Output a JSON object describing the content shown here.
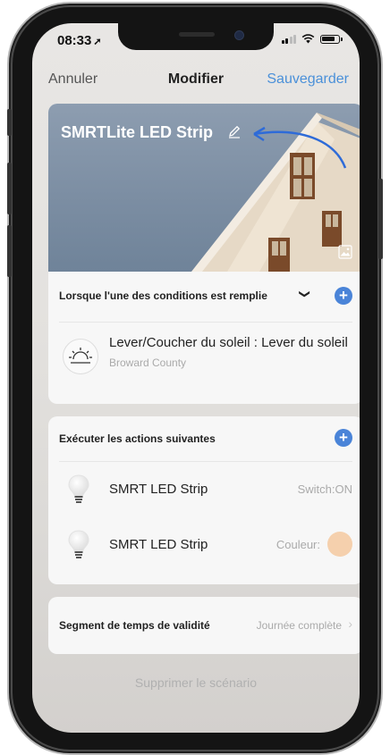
{
  "status": {
    "time": "08:33",
    "location_arrow": "➚"
  },
  "nav": {
    "cancel": "Annuler",
    "title": "Modifier",
    "save": "Sauvegarder"
  },
  "scene": {
    "name": "SMRTLite LED Strip",
    "edit_icon": "pencil-icon",
    "photo_icon": "image-icon"
  },
  "conditions": {
    "header": "Lorsque l'une des conditions est remplie",
    "chevron": "❯",
    "items": [
      {
        "title": "Lever/Coucher du soleil : Lever du soleil",
        "subtitle": "Broward County",
        "icon": "sunrise-icon"
      }
    ]
  },
  "actions": {
    "header": "Exécuter les actions suivantes",
    "items": [
      {
        "name": "SMRT LED Strip",
        "value": "Switch:ON",
        "icon": "bulb-icon"
      },
      {
        "name": "SMRT LED Strip",
        "value": "Couleur:",
        "icon": "bulb-icon",
        "color": "#f5d0ad"
      }
    ]
  },
  "validity": {
    "label": "Segment de temps de validité",
    "value": "Journée complète",
    "chevron": "›"
  },
  "delete": "Supprimer le scénario",
  "colors": {
    "accent": "#4a90d9",
    "plus": "#4a84d8"
  }
}
